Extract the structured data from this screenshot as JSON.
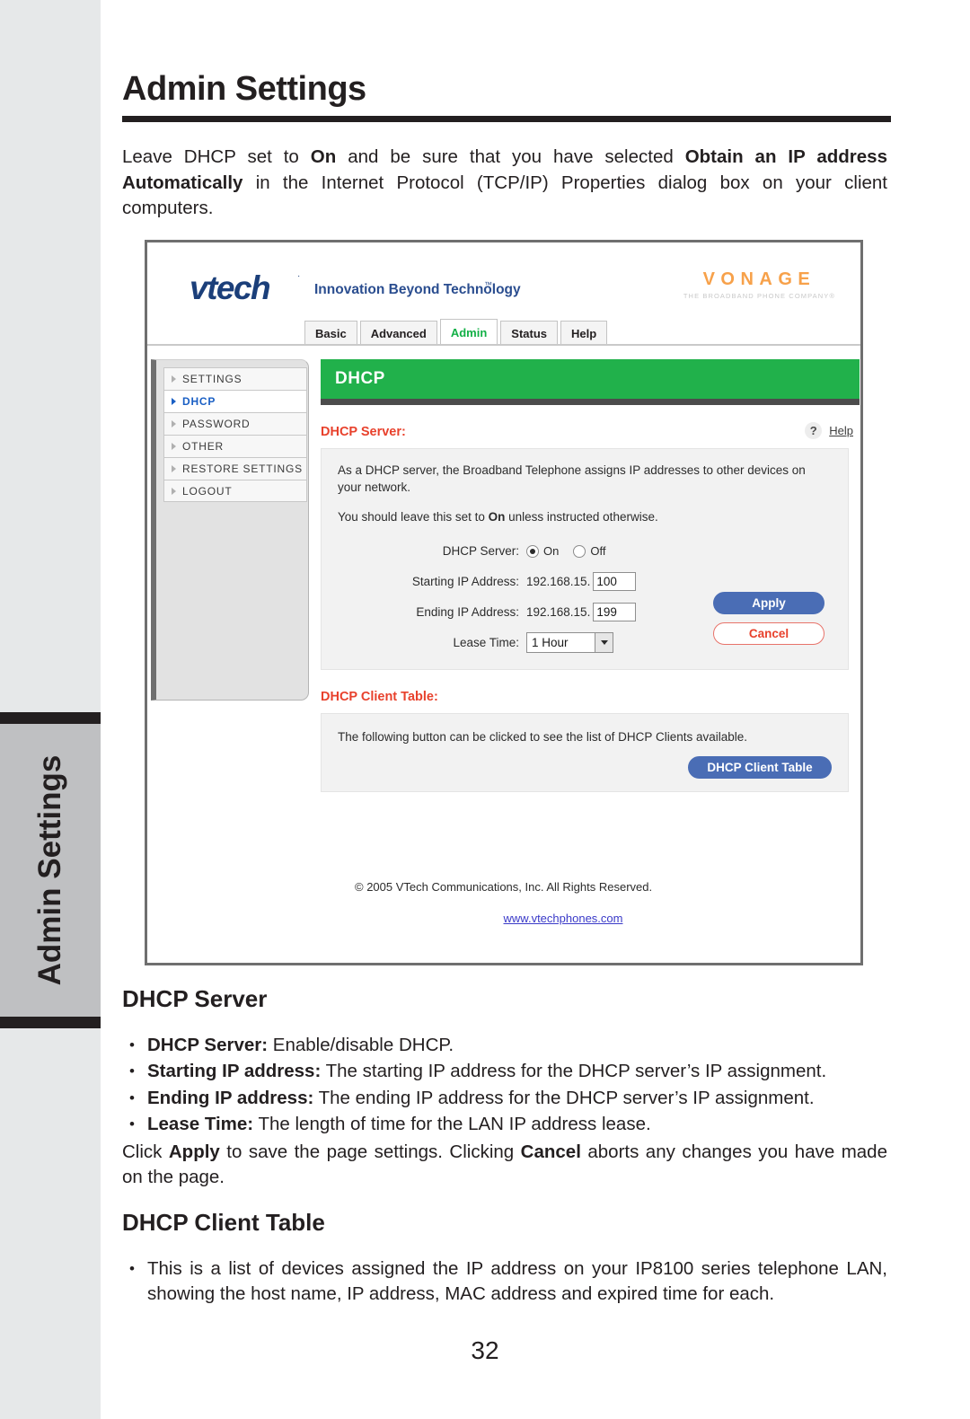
{
  "page": {
    "title": "Admin Settings",
    "number": "32",
    "edge_tab_label": "Admin Settings",
    "intro": {
      "part1": "Leave DHCP set to ",
      "bold1": "On",
      "part2": " and be sure that you have selected ",
      "bold2": "Obtain an IP address Automatically",
      "part3": " in the Internet Protocol (TCP/IP) Properties dialog box on your client computers."
    }
  },
  "screenshot": {
    "brand": {
      "vtech": "vtech",
      "vtech_tm": "·",
      "tagline": "Innovation Beyond Technology",
      "tagline_tm": "™",
      "vonage": "VONAGE",
      "vonage_sub": "THE BROADBAND PHONE COMPANY®"
    },
    "tabs": [
      {
        "label": "Basic",
        "active": false
      },
      {
        "label": "Advanced",
        "active": false
      },
      {
        "label": "Admin",
        "active": true
      },
      {
        "label": "Status",
        "active": false
      },
      {
        "label": "Help",
        "active": false
      }
    ],
    "menu": [
      {
        "label": "SETTINGS",
        "active": false
      },
      {
        "label": "DHCP",
        "active": true
      },
      {
        "label": "PASSWORD",
        "active": false
      },
      {
        "label": "OTHER",
        "active": false
      },
      {
        "label": "RESTORE SETTINGS",
        "active": false
      },
      {
        "label": "LOGOUT",
        "active": false
      }
    ],
    "banner": "DHCP",
    "server_section": {
      "label": "DHCP Server:",
      "help_icon": "?",
      "help_link": "Help",
      "description_1": "As a DHCP server, the Broadband Telephone assigns IP addresses to other devices on your network.",
      "description_2_a": "You should leave this set to ",
      "description_2_bold": "On",
      "description_2_b": " unless instructed otherwise.",
      "form": {
        "dhcp_server_label": "DHCP Server:",
        "radio_on": "On",
        "radio_off": "Off",
        "radio_selected": "On",
        "starting_label": "Starting IP Address:",
        "starting_prefix": "192.168.15.",
        "starting_value": "100",
        "ending_label": "Ending IP Address:",
        "ending_prefix": "192.168.15.",
        "ending_value": "199",
        "lease_label": "Lease Time:",
        "lease_value": "1 Hour"
      },
      "apply_button": "Apply",
      "cancel_button": "Cancel"
    },
    "client_section": {
      "label": "DHCP Client Table:",
      "description": "The following button can be clicked to see the list of DHCP Clients available.",
      "button": "DHCP Client Table"
    },
    "footer": {
      "copyright": "© 2005 VTech Communications, Inc. All Rights Reserved.",
      "url": "www.vtechphones.com"
    },
    "colors": {
      "banner_green": "#21b14b",
      "label_red": "#e8412c",
      "button_blue": "#4a6db5",
      "vonage_orange": "#f08a24",
      "vtech_navy": "#1b3f7a",
      "active_tab_green": "#12b046",
      "active_menu_blue": "#1a5fc4"
    }
  },
  "doc_sections": {
    "dhcp_server": {
      "heading": "DHCP Server",
      "bullets": [
        {
          "term": "DHCP Server:",
          "text": " Enable/disable DHCP."
        },
        {
          "term": "Starting IP address:",
          "text": " The starting IP address for the DHCP server’s IP assignment."
        },
        {
          "term": "Ending IP address:",
          "text": " The ending IP address for the DHCP server’s IP assignment."
        },
        {
          "term": "Lease Time:",
          "text": " The length of time for the LAN IP address lease."
        }
      ],
      "paragraph": {
        "a": "Click ",
        "bold_a": "Apply",
        "b": " to save the page settings. Clicking ",
        "bold_b": "Cancel",
        "c": " aborts any changes you have made on the page."
      }
    },
    "dhcp_client_table": {
      "heading": "DHCP Client Table",
      "bullets": [
        {
          "term": "",
          "text": "This is a list of devices assigned the IP address on your IP8100 series telephone LAN, showing the host name, IP address, MAC address and expired time for each."
        }
      ]
    }
  }
}
